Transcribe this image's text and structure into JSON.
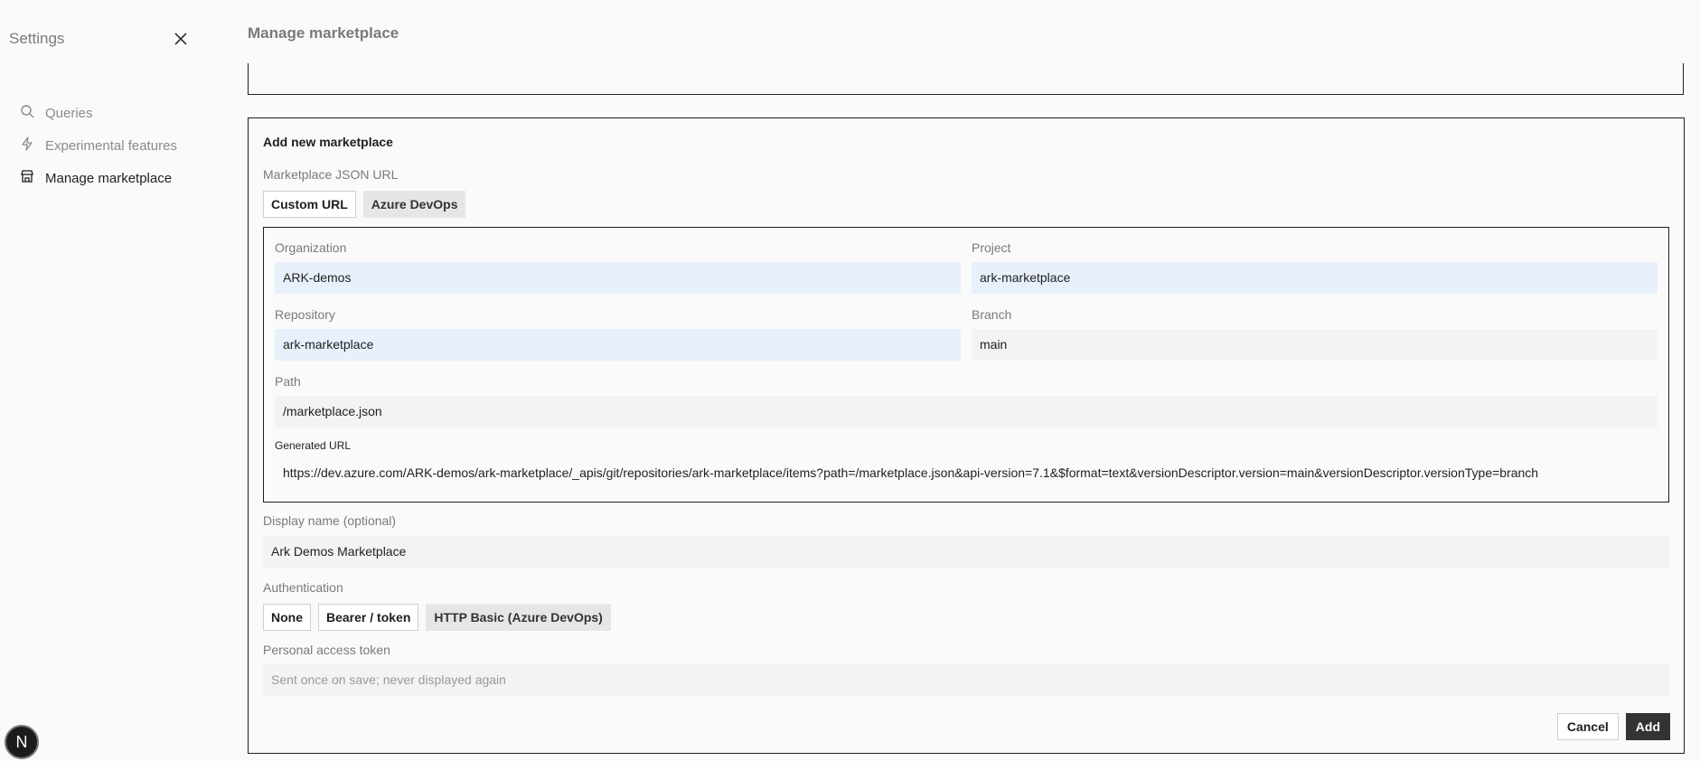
{
  "sidebar": {
    "title": "Settings",
    "items": [
      {
        "label": "Queries"
      },
      {
        "label": "Experimental features"
      },
      {
        "label": "Manage marketplace"
      }
    ],
    "badge": "N"
  },
  "main": {
    "title": "Manage marketplace",
    "form": {
      "title": "Add new marketplace",
      "url_label": "Marketplace JSON URL",
      "url_modes": [
        "Custom URL",
        "Azure DevOps"
      ],
      "url_mode_selected": "Azure DevOps",
      "organization": {
        "label": "Organization",
        "value": "ARK-demos"
      },
      "project": {
        "label": "Project",
        "value": "ark-marketplace"
      },
      "repository": {
        "label": "Repository",
        "value": "ark-marketplace"
      },
      "branch": {
        "label": "Branch",
        "value": "main"
      },
      "path": {
        "label": "Path",
        "value": "/marketplace.json"
      },
      "generated_url": {
        "label": "Generated URL",
        "value": "https://dev.azure.com/ARK-demos/ark-marketplace/_apis/git/repositories/ark-marketplace/items?path=/marketplace.json&api-version=7.1&$format=text&versionDescriptor.version=main&versionDescriptor.versionType=branch"
      },
      "display_name": {
        "label": "Display name (optional)",
        "value": "Ark Demos Marketplace"
      },
      "auth_label": "Authentication",
      "auth_modes": [
        "None",
        "Bearer / token",
        "HTTP Basic (Azure DevOps)"
      ],
      "auth_selected": "HTTP Basic (Azure DevOps)",
      "token": {
        "label": "Personal access token",
        "placeholder": "Sent once on save; never displayed again",
        "value": ""
      },
      "cancel_label": "Cancel",
      "add_label": "Add"
    }
  }
}
